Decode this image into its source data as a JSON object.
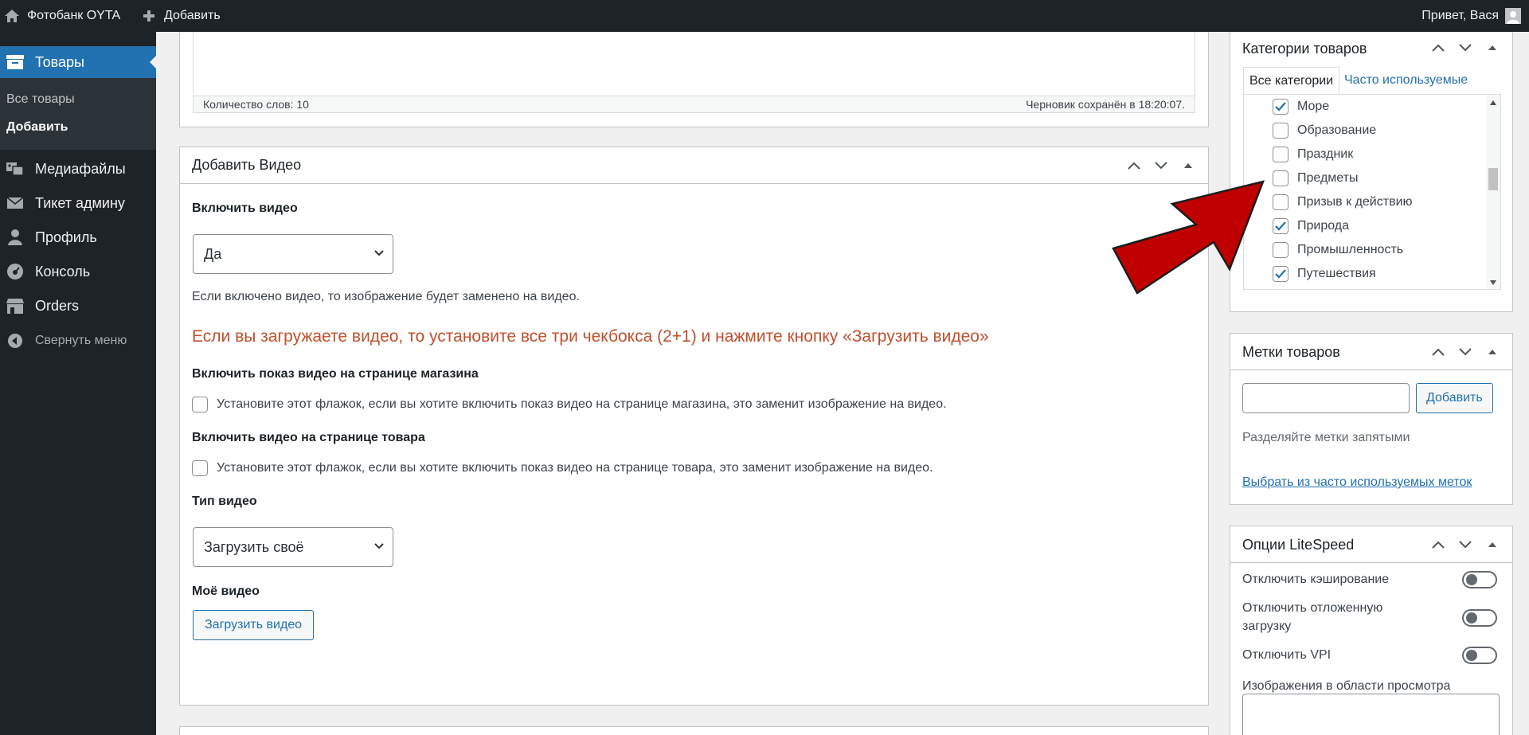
{
  "adminbar": {
    "site_name": "Фотобанк OYTA",
    "new_label": "Добавить",
    "greeting": "Привет, Вася"
  },
  "sidebar": {
    "current": "Товары",
    "submenu": [
      "Все товары",
      "Добавить"
    ],
    "items": [
      {
        "label": "Медиафайлы",
        "icon": "media-icon"
      },
      {
        "label": "Тикет админу",
        "icon": "envelope-icon"
      },
      {
        "label": "Профиль",
        "icon": "user-icon"
      },
      {
        "label": "Консоль",
        "icon": "dashboard-icon"
      },
      {
        "label": "Orders",
        "icon": "store-icon"
      },
      {
        "label": "Свернуть меню",
        "icon": "collapse-icon"
      }
    ]
  },
  "editor": {
    "word_count": "Количество слов: 10",
    "draft_saved": "Черновик сохранён в 18:20:07."
  },
  "video_box": {
    "title": "Добавить Видео",
    "enable_label": "Включить видео",
    "enable_value": "Да",
    "enable_desc": "Если включено видео, то изображение будет заменено на видео.",
    "warning": "Если вы загружаете видео, то установите все три чекбокса (2+1) и нажмите кнопку «Загрузить видео»",
    "shop_label": "Включить показ видео на странице магазина",
    "shop_desc": "Установите этот флажок, если вы хотите включить показ видео на странице магазина, это заменит изображение на видео.",
    "product_label": "Включить видео на странице товара",
    "product_desc": "Установите этот флажок, если вы хотите включить показ видео на странице товара, это заменит изображение на видео.",
    "type_label": "Тип видео",
    "type_value": "Загрузить своё",
    "my_video_label": "Моё видео",
    "upload_button": "Загрузить видео"
  },
  "categories": {
    "title": "Категории товаров",
    "tab_all": "Все категории",
    "tab_popular": "Часто используемые",
    "items": [
      {
        "label": "Море",
        "checked": true
      },
      {
        "label": "Образование",
        "checked": false
      },
      {
        "label": "Праздник",
        "checked": false
      },
      {
        "label": "Предметы",
        "checked": false
      },
      {
        "label": "Призыв к действию",
        "checked": false
      },
      {
        "label": "Природа",
        "checked": true
      },
      {
        "label": "Промышленность",
        "checked": false
      },
      {
        "label": "Путешествия",
        "checked": true
      }
    ]
  },
  "tags": {
    "title": "Метки товаров",
    "add_button": "Добавить",
    "hint": "Разделяйте метки запятыми",
    "popular_link": "Выбрать из часто используемых меток"
  },
  "litespeed": {
    "title": "Опции LiteSpeed",
    "options": [
      {
        "label": "Отключить кэширование",
        "on": false
      },
      {
        "label": "Отключить отложенную загрузку",
        "on": false
      },
      {
        "label": "Отключить VPI",
        "on": false
      }
    ],
    "viewport_label": "Изображения в области просмотра"
  },
  "colors": {
    "accent": "#2271b1",
    "warning_text": "#c0502d",
    "annotation_arrow": "#c00000"
  }
}
